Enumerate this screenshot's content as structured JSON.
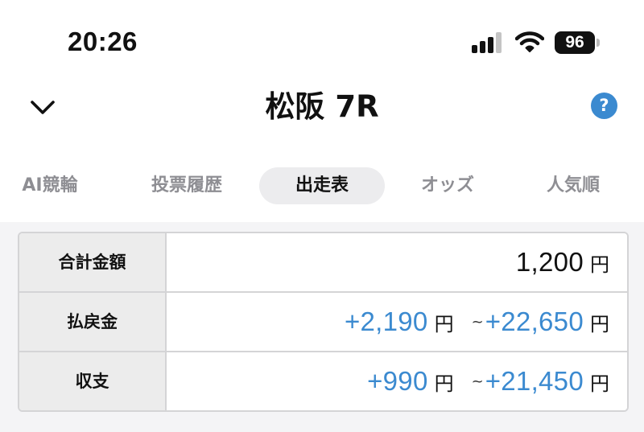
{
  "status_bar": {
    "time": "20:26",
    "battery": "96"
  },
  "header": {
    "title": "松阪 7R",
    "help_symbol": "?"
  },
  "tabs": [
    {
      "label": "AI競輪",
      "active": false
    },
    {
      "label": "投票履歴",
      "active": false
    },
    {
      "label": "出走表",
      "active": true
    },
    {
      "label": "オッズ",
      "active": false
    },
    {
      "label": "人気順",
      "active": false
    }
  ],
  "summary": {
    "currency": "円",
    "range_separator": "~",
    "rows": [
      {
        "label": "合計金額",
        "value": "1,200"
      },
      {
        "label": "払戻金",
        "min": "+2,190",
        "max": "+22,650"
      },
      {
        "label": "収支",
        "min": "+990",
        "max": "+21,450"
      }
    ]
  },
  "colors": {
    "accent": "#3b8ad0",
    "active_tab_bg": "#ececee",
    "label_cell_bg": "#ececec",
    "summary_bg": "#f4f4f6"
  }
}
